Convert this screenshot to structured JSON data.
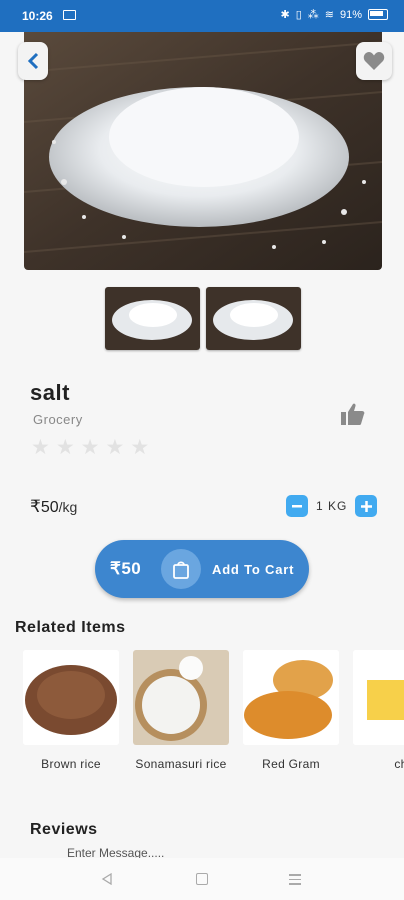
{
  "status_bar": {
    "time": "10:26",
    "battery": "91%",
    "icons": [
      "screen-icon",
      "bluetooth-icon",
      "vibrate-icon",
      "signal-icon",
      "wifi-icon",
      "battery-icon"
    ]
  },
  "product": {
    "name": "salt",
    "category": "Grocery",
    "rating_stars": 5,
    "rating_filled": 0,
    "price_symbol": "₹",
    "price": "50",
    "unit": "/kg",
    "quantity": "1 KG",
    "cart_price": "₹50",
    "add_to_cart_label": "Add To Cart"
  },
  "related": {
    "title": "Related Items",
    "items": [
      {
        "label": "Brown rice"
      },
      {
        "label": "Sonamasuri rice"
      },
      {
        "label": "Red Gram"
      },
      {
        "label": "ch"
      }
    ]
  },
  "reviews": {
    "title": "Reviews",
    "placeholder": "Enter Message....."
  },
  "colors": {
    "status_bar": "#1f6fc0",
    "accent": "#3d86cf",
    "qty_button": "#41aaf0"
  }
}
